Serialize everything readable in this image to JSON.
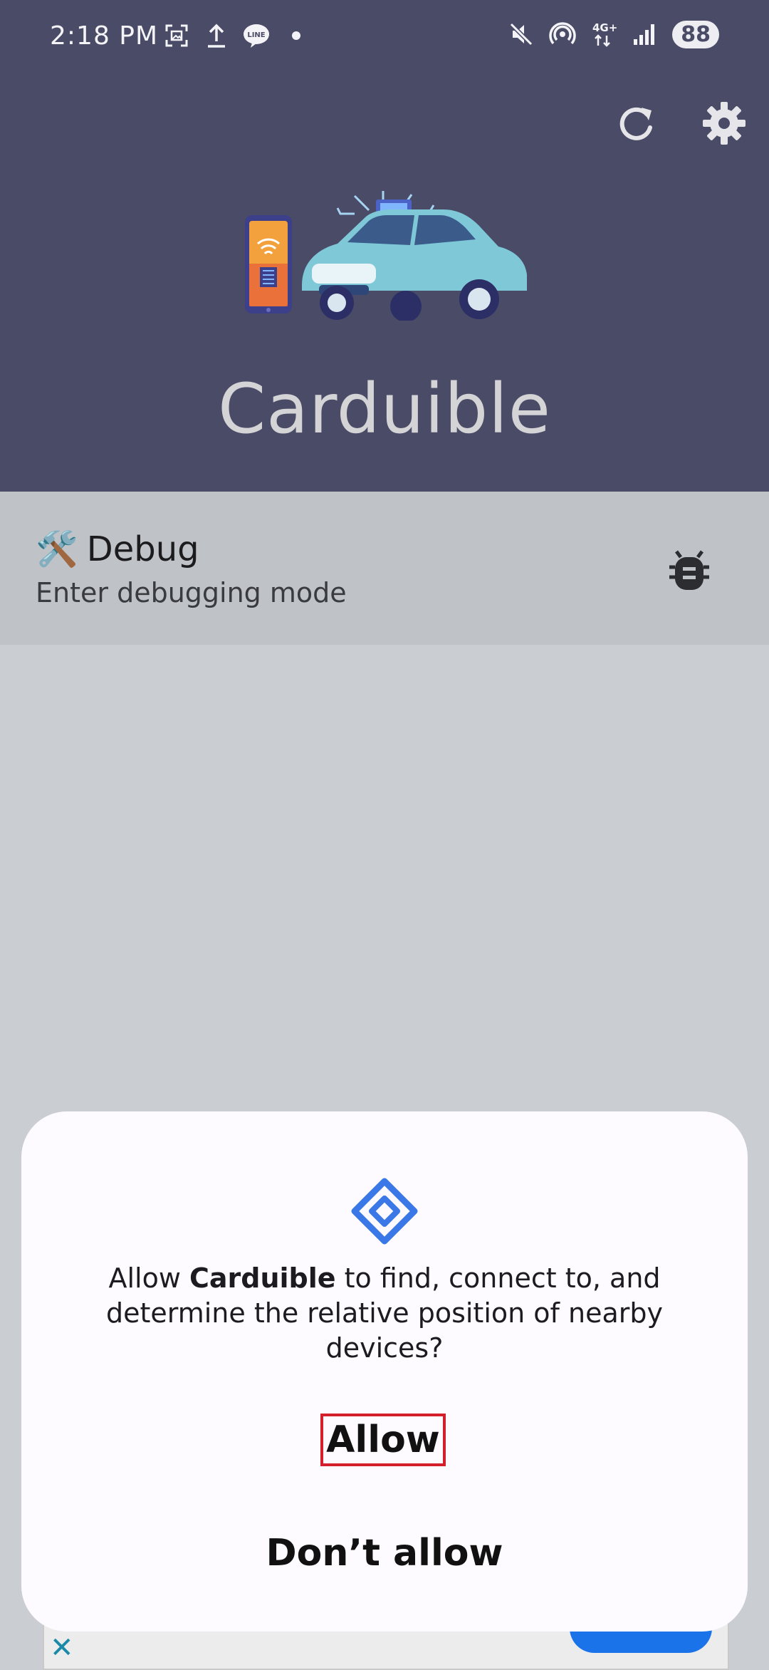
{
  "status_bar": {
    "time": "2:18 PM",
    "battery": "88",
    "icons_left": [
      "screenshot-icon",
      "upload-icon",
      "line-app-icon",
      "dot-icon"
    ],
    "icons_right": [
      "mute-icon",
      "hotspot-icon",
      "network-4g-icon",
      "signal-icon"
    ]
  },
  "header": {
    "app_name": "Carduible",
    "background_color": "#4a4b66"
  },
  "debug": {
    "emoji": "🛠️",
    "title": "Debug",
    "subtitle": "Enter debugging mode"
  },
  "dialog": {
    "message_prefix": "Allow ",
    "app_name": "Carduible",
    "message_suffix": " to find, connect to, and determine the relative position of nearby devices?",
    "allow_label": "Allow",
    "deny_label": "Don’t allow",
    "accent_color": "#3b78e7"
  }
}
